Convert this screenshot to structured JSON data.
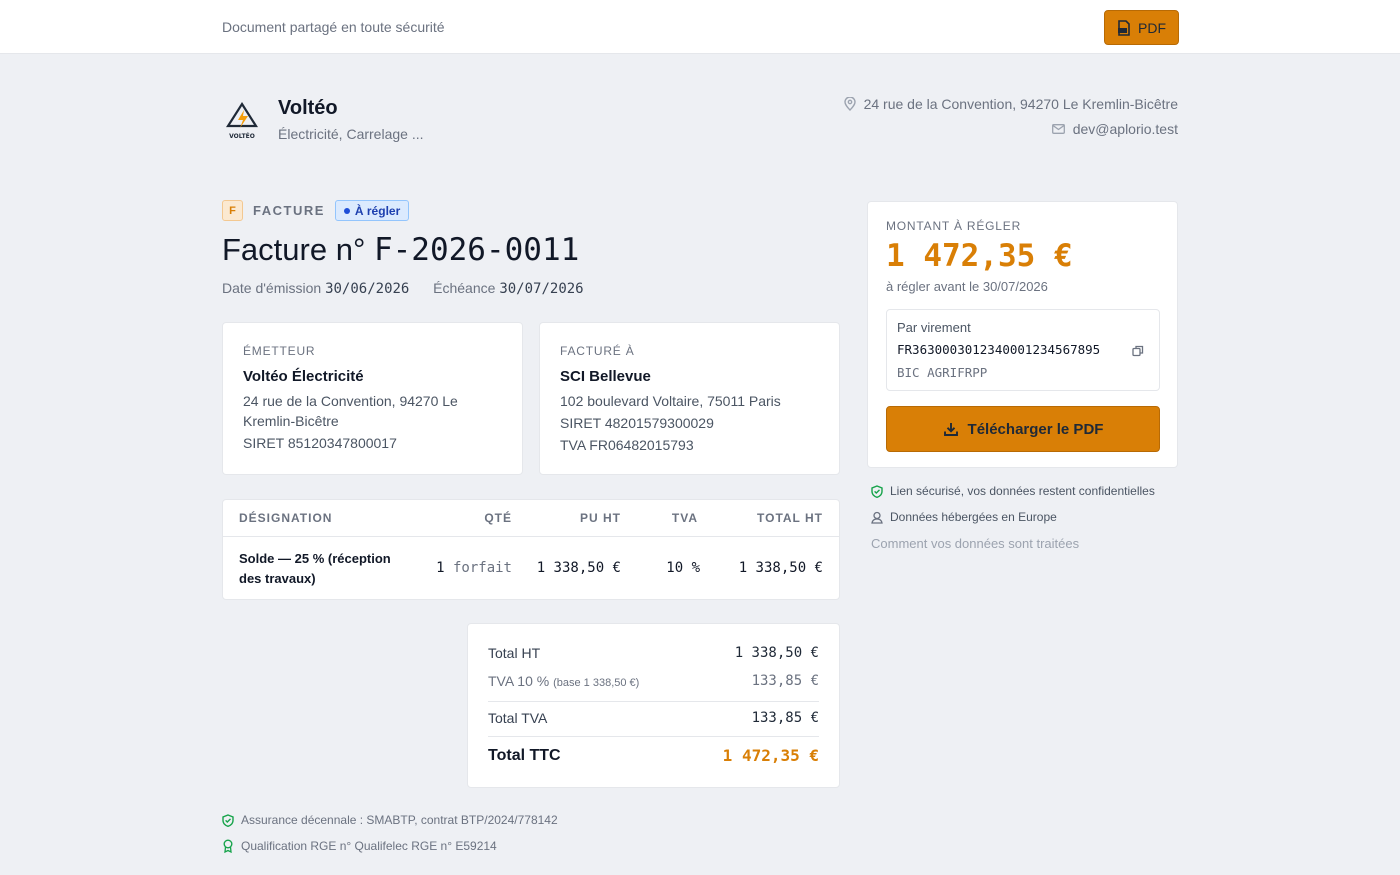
{
  "topbar": {
    "text": "Document partagé en toute sécurité",
    "pdf_button": "PDF"
  },
  "company": {
    "logo_text": "VOLTÉO",
    "name": "Voltéo",
    "tagline": "Électricité, Carrelage ...",
    "address": "24 rue de la Convention, 94270 Le Kremlin-Bicêtre",
    "email": "dev@aplorio.test"
  },
  "document": {
    "badge_letter": "F",
    "type": "FACTURE",
    "status": "À régler",
    "title_prefix": "Facture n°",
    "number": "F-2026-0011",
    "issue_label": "Date d'émission",
    "issue_date": "30/06/2026",
    "due_label": "Échéance",
    "due_date": "30/07/2026"
  },
  "issuer": {
    "label": "ÉMETTEUR",
    "name": "Voltéo Électricité",
    "address_line1": "24 rue de la Convention, 94270 Le",
    "address_line2": "Kremlin-Bicêtre",
    "siret": "SIRET 85120347800017"
  },
  "billed_to": {
    "label": "FACTURÉ À",
    "name": "SCI Bellevue",
    "address": "102 boulevard Voltaire, 75011 Paris",
    "siret": "SIRET 48201579300029",
    "vat": "TVA FR06482015793"
  },
  "items": {
    "headers": {
      "designation": "DÉSIGNATION",
      "qty": "QTÉ",
      "unit_price": "PU HT",
      "vat": "TVA",
      "total": "TOTAL HT"
    },
    "rows": [
      {
        "designation_line1": "Solde — 25 % (réception",
        "designation_line2": "des travaux)",
        "qty": "1",
        "unit": "forfait",
        "unit_price": "1 338,50 €",
        "vat": "10 %",
        "total": "1 338,50 €"
      }
    ]
  },
  "totals": {
    "ht_label": "Total HT",
    "ht_value": "1 338,50 €",
    "vat_line_label": "TVA 10 %",
    "vat_line_base": "(base 1 338,50 €)",
    "vat_line_value": "133,85 €",
    "vat_total_label": "Total TVA",
    "vat_total_value": "133,85 €",
    "ttc_label": "Total TTC",
    "ttc_value": "1 472,35 €"
  },
  "footer": {
    "insurance": "Assurance décennale : SMABTP, contrat BTP/2024/778142",
    "qualification": "Qualification RGE n° Qualifelec RGE n° E59214"
  },
  "payment": {
    "label": "MONTANT À RÉGLER",
    "amount": "1 472,35 €",
    "due_text": "à régler avant le 30/07/2026",
    "method": "Par virement",
    "iban": "FR3630003012340001234567895",
    "bic": "BIC AGRIFRPP",
    "download_button": "Télécharger le PDF"
  },
  "trust": {
    "secure": "Lien sécurisé, vos données restent confidentielles",
    "hosting": "Données hébergées en Europe",
    "link": "Comment vos données sont traitées"
  },
  "colors": {
    "accent": "#d97f06",
    "background": "#eef0f4",
    "status_blue": "#1e40af",
    "trust_green": "#16a34a"
  },
  "icons": [
    "pdf-file-icon",
    "location-pin-icon",
    "mail-icon",
    "copy-icon",
    "download-icon",
    "shield-check-icon",
    "user-location-icon",
    "award-icon"
  ]
}
